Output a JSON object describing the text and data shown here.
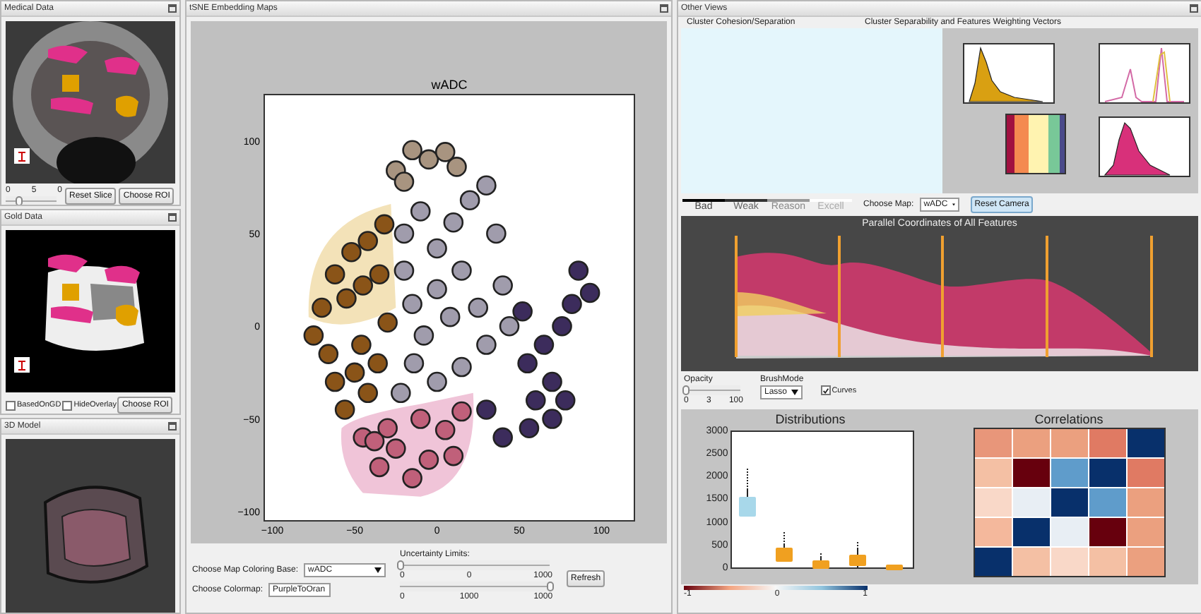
{
  "medical_data": {
    "title": "Medical Data",
    "slider_labels": [
      "0",
      "5",
      "0"
    ],
    "slider": {
      "level": 0.25
    },
    "buttons": [
      "Reset Slice",
      "Choose ROI"
    ]
  },
  "gold_data": {
    "title": "Gold Data",
    "checkboxes": [
      {
        "label": "BasedOnGD",
        "checked": false
      },
      {
        "label": "HideOverlay",
        "checked": false
      }
    ],
    "button": "Choose ROI"
  },
  "model_3d": {
    "title": "3D Model"
  },
  "tsne": {
    "title": "tSNE Embedding Maps",
    "chart_data": {
      "type": "scatter",
      "title": "wADC",
      "xlim": [
        -105,
        120
      ],
      "ylim": [
        -105,
        125
      ],
      "xticks": [
        {
          "value": -100,
          "label": "−100"
        },
        {
          "value": -50,
          "label": "−50"
        },
        {
          "value": 0,
          "label": "0"
        },
        {
          "value": 50,
          "label": "50"
        },
        {
          "value": 100,
          "label": "100"
        }
      ],
      "yticks": [
        {
          "value": -100,
          "label": "−100"
        },
        {
          "value": -50,
          "label": "−50"
        },
        {
          "value": 0,
          "label": "0"
        },
        {
          "value": 50,
          "label": "50"
        },
        {
          "value": 100,
          "label": "100"
        }
      ],
      "series": [
        {
          "color": "#8a5418",
          "x": [
            -70,
            -62,
            -52,
            -42,
            -32,
            -55,
            -45,
            -35,
            -66,
            -62,
            -56,
            -46,
            -36,
            -30,
            -42,
            -75,
            -50
          ],
          "values": [
            10,
            28,
            40,
            46,
            55,
            15,
            22,
            28,
            -15,
            -30,
            -45,
            -10,
            -20,
            2,
            -36,
            -5,
            -25
          ]
        },
        {
          "color": "#a09cac",
          "x": [
            -20,
            -10,
            0,
            10,
            20,
            30,
            36,
            15,
            0,
            -15,
            25,
            40,
            30,
            15,
            0,
            -14,
            -22,
            44,
            -8,
            8,
            -20
          ],
          "values": [
            50,
            62,
            42,
            56,
            68,
            76,
            50,
            30,
            20,
            12,
            10,
            22,
            -10,
            -22,
            -30,
            -20,
            -36,
            0,
            -5,
            5,
            30
          ]
        },
        {
          "color": "#3c2c5c",
          "x": [
            55,
            60,
            70,
            65,
            76,
            82,
            86,
            93,
            56,
            40,
            30,
            70,
            52,
            78
          ],
          "values": [
            -20,
            -40,
            -30,
            -10,
            0,
            12,
            30,
            18,
            -55,
            -60,
            -45,
            -50,
            8,
            -40
          ]
        },
        {
          "color": "#a89480",
          "x": [
            -25,
            -15,
            -5,
            5,
            12,
            -20
          ],
          "values": [
            84,
            95,
            90,
            94,
            86,
            78
          ]
        },
        {
          "color": "#c0607a",
          "x": [
            -45,
            -35,
            -25,
            -15,
            -5,
            5,
            15,
            -10,
            -30,
            10,
            -38
          ],
          "values": [
            -60,
            -76,
            -66,
            -82,
            -72,
            -56,
            -46,
            -50,
            -55,
            -70,
            -62
          ]
        }
      ]
    },
    "controls": {
      "coloring_base_label": "Choose Map Coloring Base:",
      "coloring_base": "wADC",
      "colormap_label": "Choose Colormap:",
      "colormap": "PurpleToOran",
      "uncertainty_label": "Uncertainty Limits:",
      "sliders": [
        {
          "level": 0,
          "labels": [
            "0",
            "0",
            "1000"
          ]
        },
        {
          "level": 1,
          "labels": [
            "0",
            "1000",
            "1000"
          ]
        }
      ],
      "refresh": "Refresh"
    }
  },
  "other_views": {
    "title": "Other Views",
    "headers": [
      "Cluster Cohesion/Separation",
      "Cluster Separability and Features Weighting Vectors"
    ],
    "quality_legend": [
      {
        "label": "Bad",
        "color": "#000000"
      },
      {
        "label": "Weak",
        "color": "#333333"
      },
      {
        "label": "Reason",
        "color": "#999999"
      },
      {
        "label": "Excell",
        "color": "#ffffff"
      }
    ],
    "map_label": "Choose Map:",
    "map": "wADC",
    "reset_camera": "Reset Camera",
    "parallel_title": "Parallel Coordinates of All Features",
    "opacity": {
      "label": "Opacity",
      "level": 0.03,
      "labels": [
        "0",
        "3",
        "100"
      ]
    },
    "brush_mode": {
      "label": "BrushMode",
      "value": "Lasso"
    },
    "curves": {
      "label": "Curves",
      "checked": true
    },
    "distributions": {
      "title": "Distributions",
      "yticks": [
        "3000",
        "2500",
        "2000",
        "1500",
        "1000",
        "500",
        "0"
      ]
    },
    "correlations": {
      "title": "Correlations",
      "cells": [
        [
          {
            "color": "#e8967a"
          },
          {
            "color": "#eba07f"
          },
          {
            "color": "#eba07f"
          },
          {
            "color": "#e07a63"
          },
          {
            "color": "#08306b"
          }
        ],
        [
          {
            "color": "#f4c0a4"
          },
          {
            "color": "#67000d"
          },
          {
            "color": "#5f9ccb"
          },
          {
            "color": "#08306b"
          },
          {
            "color": "#e07a63"
          }
        ],
        [
          {
            "color": "#f9d8c8"
          },
          {
            "color": "#e8eef4"
          },
          {
            "color": "#08306b"
          },
          {
            "color": "#5f9ccb"
          },
          {
            "color": "#eba07f"
          }
        ],
        [
          {
            "color": "#f4b89c"
          },
          {
            "color": "#08306b"
          },
          {
            "color": "#e8eef4"
          },
          {
            "color": "#67000d"
          },
          {
            "color": "#eba07f"
          }
        ],
        [
          {
            "color": "#08306b"
          },
          {
            "color": "#f4c0a4"
          },
          {
            "color": "#f9d8c8"
          },
          {
            "color": "#f4c0a4"
          },
          {
            "color": "#eba07f"
          }
        ]
      ]
    },
    "colorbar": [
      "-1",
      "0",
      "1"
    ]
  }
}
